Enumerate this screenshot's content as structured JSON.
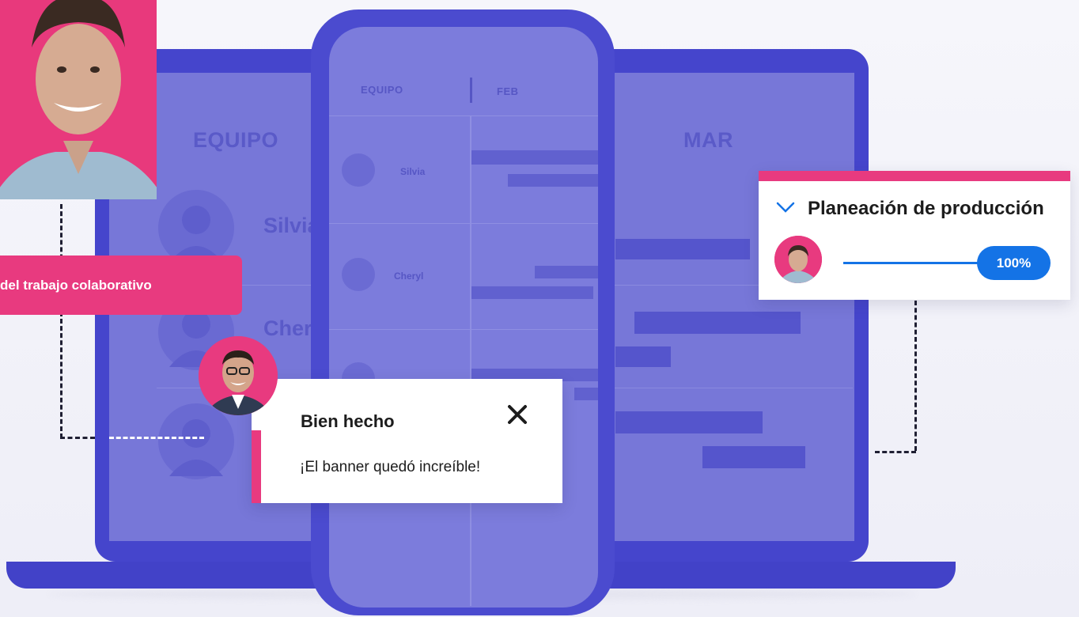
{
  "laptop": {
    "header_team": "EQUIPO",
    "header_month": "MAR",
    "names": [
      "Silvia",
      "Chery"
    ]
  },
  "phone": {
    "header_team": "EQUIPO",
    "header_month": "FEB",
    "names": [
      "Silvia",
      "Cheryl"
    ]
  },
  "banner": {
    "text": "del trabajo colaborativo"
  },
  "notification": {
    "title": "Bien hecho",
    "message": "¡El banner quedó increíble!",
    "close_icon": "close-icon"
  },
  "production": {
    "title": "Planeación de producción",
    "progress_label": "100%",
    "progress": 1.0,
    "chevron_icon": "chevron-down-icon"
  },
  "colors": {
    "brand_pink": "#e83a7f",
    "laptop_frame": "#4545cc",
    "screen": "#7777d8",
    "progress_blue": "#1473e6"
  }
}
